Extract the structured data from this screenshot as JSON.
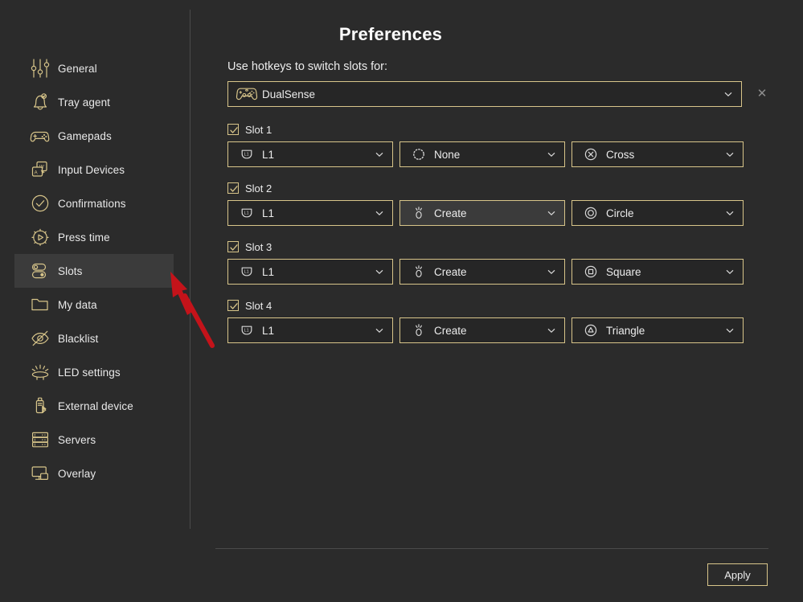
{
  "window": {
    "background": "#2b2b2b",
    "accent": "#d8c58a"
  },
  "sidebar": {
    "items": [
      {
        "label": "General",
        "icon": "sliders-icon",
        "selected": false
      },
      {
        "label": "Tray agent",
        "icon": "bell-icon",
        "selected": false
      },
      {
        "label": "Gamepads",
        "icon": "gamepad-icon",
        "selected": false
      },
      {
        "label": "Input Devices",
        "icon": "input-devices-icon",
        "selected": false
      },
      {
        "label": "Confirmations",
        "icon": "check-circle-icon",
        "selected": false
      },
      {
        "label": "Press time",
        "icon": "play-timer-icon",
        "selected": false
      },
      {
        "label": "Slots",
        "icon": "toggles-icon",
        "selected": true
      },
      {
        "label": "My data",
        "icon": "folder-icon",
        "selected": false
      },
      {
        "label": "Blacklist",
        "icon": "eye-off-icon",
        "selected": false
      },
      {
        "label": "LED settings",
        "icon": "led-icon",
        "selected": false
      },
      {
        "label": "External device",
        "icon": "usb-bluetooth-icon",
        "selected": false
      },
      {
        "label": "Servers",
        "icon": "servers-icon",
        "selected": false
      },
      {
        "label": "Overlay",
        "icon": "overlay-icon",
        "selected": false
      }
    ]
  },
  "main": {
    "title": "Preferences",
    "hotkey_label": "Use hotkeys to switch slots for:",
    "device": {
      "value": "DualSense",
      "icon": "dualsense-gamepad-icon",
      "clear_label": "✕"
    },
    "slots": [
      {
        "name": "Slot 1",
        "checked": true,
        "combo": [
          {
            "value": "L1",
            "icon": "l1-bumper-icon",
            "hover": false
          },
          {
            "value": "None",
            "icon": "none-dotted-icon",
            "hover": false
          },
          {
            "value": "Cross",
            "icon": "cross-icon",
            "hover": false
          }
        ]
      },
      {
        "name": "Slot 2",
        "checked": true,
        "combo": [
          {
            "value": "L1",
            "icon": "l1-bumper-icon",
            "hover": false
          },
          {
            "value": "Create",
            "icon": "create-icon",
            "hover": true
          },
          {
            "value": "Circle",
            "icon": "circle-icon",
            "hover": false
          }
        ]
      },
      {
        "name": "Slot 3",
        "checked": true,
        "combo": [
          {
            "value": "L1",
            "icon": "l1-bumper-icon",
            "hover": false
          },
          {
            "value": "Create",
            "icon": "create-icon",
            "hover": false
          },
          {
            "value": "Square",
            "icon": "square-icon",
            "hover": false
          }
        ]
      },
      {
        "name": "Slot 4",
        "checked": true,
        "combo": [
          {
            "value": "L1",
            "icon": "l1-bumper-icon",
            "hover": false
          },
          {
            "value": "Create",
            "icon": "create-icon",
            "hover": false
          },
          {
            "value": "Triangle",
            "icon": "triangle-icon",
            "hover": false
          }
        ]
      }
    ],
    "apply_label": "Apply"
  },
  "annotation": {
    "arrow_color": "#c4131a"
  }
}
